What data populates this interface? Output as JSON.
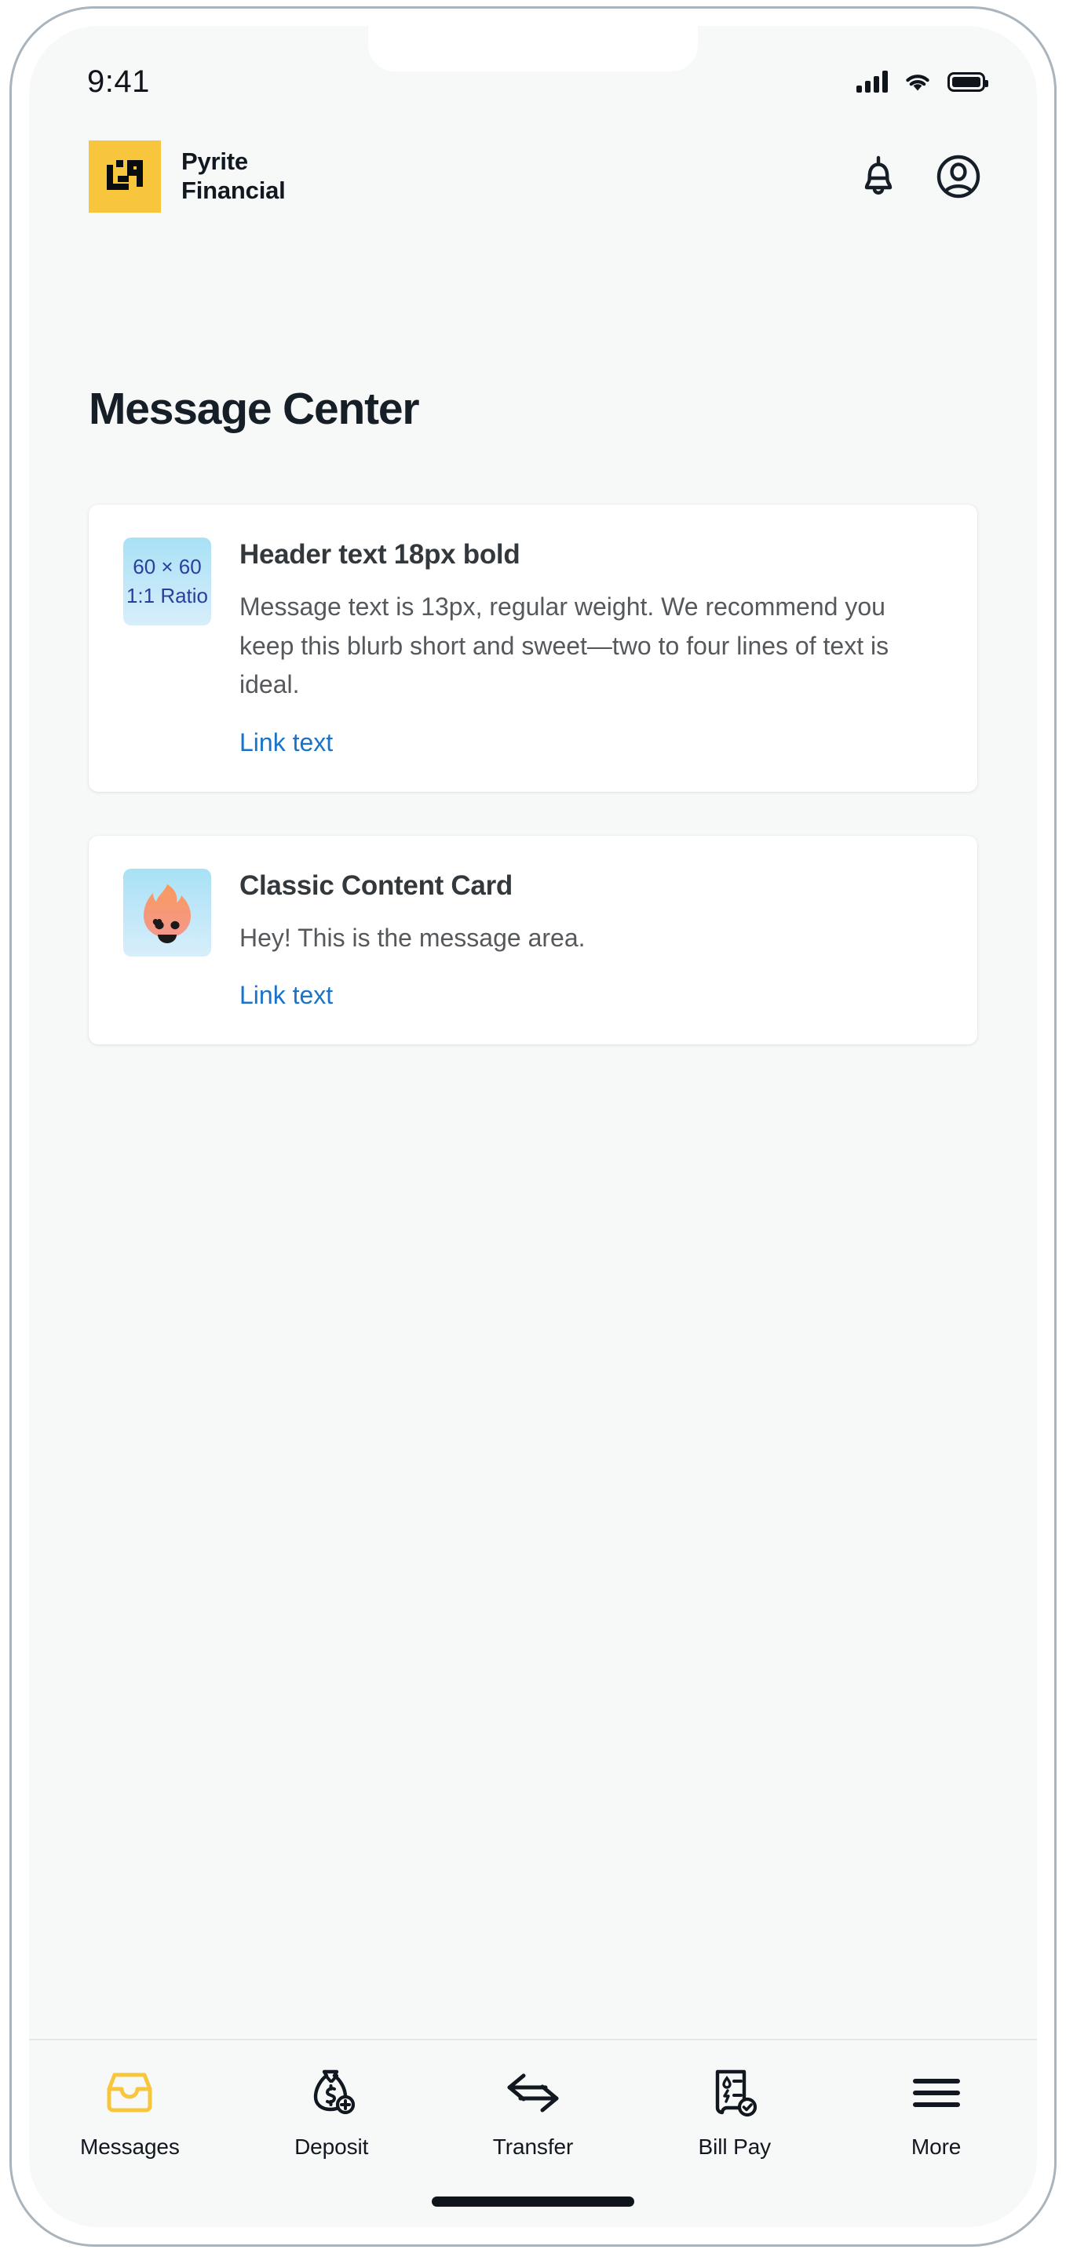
{
  "status_bar": {
    "time": "9:41",
    "icons": [
      "signal-bars-icon",
      "wifi-icon",
      "battery-icon"
    ]
  },
  "header": {
    "brand_name": "Pyrite\nFinancial",
    "logo_icon": "pyrite-logo-icon",
    "logo_color": "#f8c63d",
    "actions": [
      {
        "name": "notifications",
        "icon": "bell-icon"
      },
      {
        "name": "account",
        "icon": "account-circle-icon"
      }
    ]
  },
  "page": {
    "title": "Message Center"
  },
  "cards": [
    {
      "thumb_type": "placeholder",
      "thumb_line1": "60 × 60",
      "thumb_line2": "1:1 Ratio",
      "title": "Header text 18px bold",
      "text": "Message text is 13px, regular weight. We recommend you keep this blurb short and sweet—two to four lines of text is ideal.",
      "link": "Link text"
    },
    {
      "thumb_type": "flame",
      "thumb_icon": "flame-mascot-icon",
      "title": "Classic Content Card",
      "text": "Hey! This is the message area.",
      "link": "Link text"
    }
  ],
  "bottom_nav": {
    "active_index": 0,
    "active_color": "#f8c63d",
    "inactive_color": "#12181f",
    "items": [
      {
        "label": "Messages",
        "icon": "inbox-tray-icon"
      },
      {
        "label": "Deposit",
        "icon": "money-bag-plus-icon"
      },
      {
        "label": "Transfer",
        "icon": "transfer-arrows-icon"
      },
      {
        "label": "Bill Pay",
        "icon": "bill-check-icon"
      },
      {
        "label": "More",
        "icon": "hamburger-menu-icon"
      }
    ]
  },
  "colors": {
    "screen_bg": "#f7f9f9",
    "card_bg": "#ffffff",
    "brand_yellow": "#f8c63d",
    "link_blue": "#1a73c8",
    "title_dark": "#161e27",
    "thumb_blue_text": "#2a3f9d"
  }
}
